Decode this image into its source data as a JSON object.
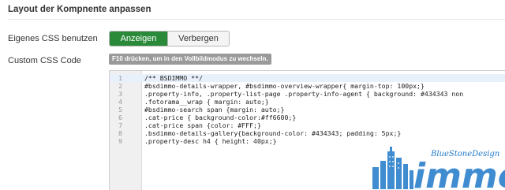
{
  "section": {
    "title": "Layout der Kompnente anpassen"
  },
  "css_toggle": {
    "label": "Eigenes CSS benutzen",
    "show_label": "Anzeigen",
    "hide_label": "Verbergen",
    "selected": "Anzeigen"
  },
  "custom_css": {
    "label": "Custom CSS Code",
    "hint": "F10 drücken, um in den Vollbildmodus zu wechseln.",
    "lines": [
      {
        "num": "1",
        "code": "/** BSDIMMO **/"
      },
      {
        "num": "2",
        "code": "#bsdimmo-details-wrapper, #bsdimmo-overview-wrapper{ margin-top: 100px;}"
      },
      {
        "num": "3",
        "code": ".property-info, .property-list-page .property-info-agent { background: #434343 non"
      },
      {
        "num": "4",
        "code": ".fotorama__wrap { margin: auto;}"
      },
      {
        "num": "5",
        "code": "#bsdimmo-search span {margin: auto;}"
      },
      {
        "num": "6",
        "code": ".cat-price { background-color:#ff6600;}"
      },
      {
        "num": "7",
        "code": ".cat-price span {color: #FFF;}"
      },
      {
        "num": "8",
        "code": ".bsdimmo-details-gallery{background-color: #434343; padding: 5px;}"
      },
      {
        "num": "9",
        "code": ".property-desc h4 { height: 40px;}"
      }
    ]
  },
  "watermark": {
    "brand": "BlueStoneDesign",
    "word": "immo"
  },
  "colors": {
    "active_toggle": "#2a8a3a",
    "hint_bg": "#9a9a9a",
    "watermark_blue": "#1f78c8"
  }
}
